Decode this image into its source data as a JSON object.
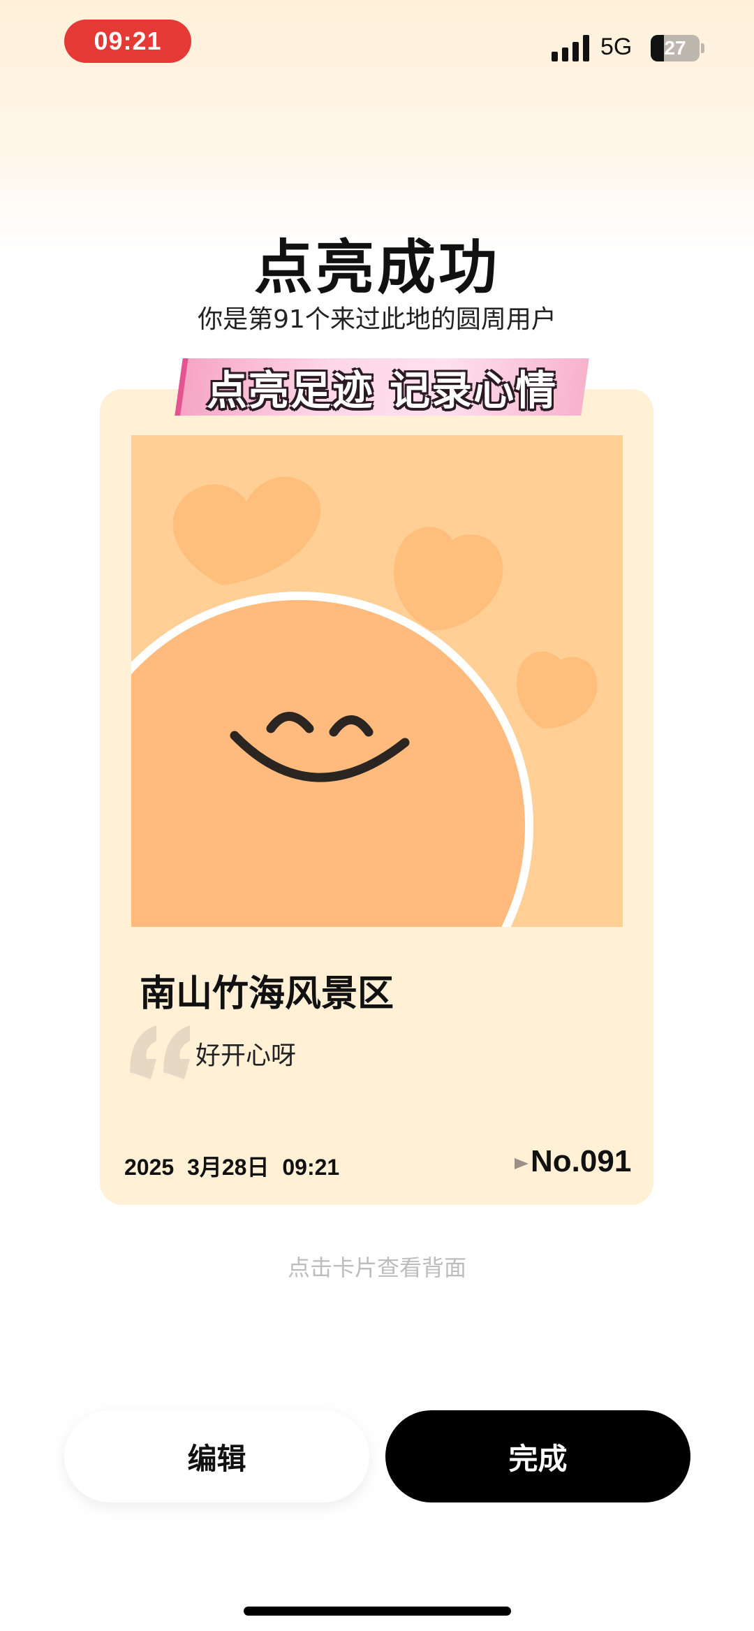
{
  "status_bar": {
    "time": "09:21",
    "network": "5G",
    "battery_level": "27",
    "battery_fraction": 0.27
  },
  "title": "点亮成功",
  "subtitle": "你是第91个来过此地的圆周用户",
  "card": {
    "banner": "点亮足迹 记录心情",
    "place_name": "南山竹海风景区",
    "mood": "好开心呀",
    "date": "2025 3月28日 09:21",
    "number": "No.091",
    "colors": {
      "card_bg": "#fff0d6",
      "photo_bg": "#ffcf95",
      "smiley": "#ffb877"
    }
  },
  "hint": "点击卡片查看背面",
  "buttons": {
    "edit": "编辑",
    "done": "完成"
  },
  "icons": [
    "signal-icon",
    "battery-icon",
    "quote-icon",
    "arrow-right-icon"
  ]
}
